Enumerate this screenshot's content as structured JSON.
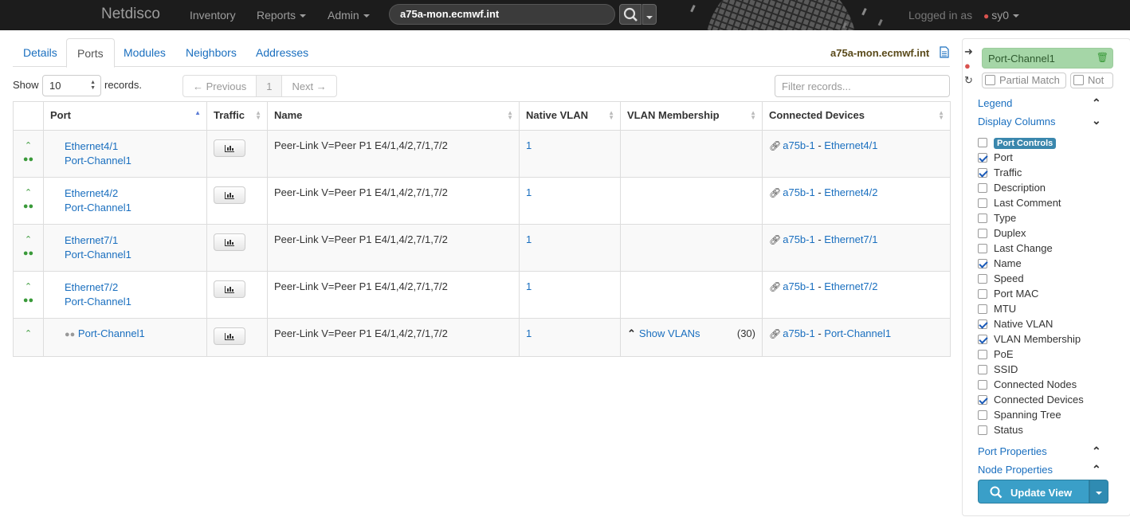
{
  "nav": {
    "brand": "Netdisco",
    "items": [
      {
        "label": "Inventory",
        "dropdown": false
      },
      {
        "label": "Reports",
        "dropdown": true
      },
      {
        "label": "Admin",
        "dropdown": true
      }
    ],
    "search_value": "a75a-mon.ecmwf.int",
    "logged_in_label": "Logged in as",
    "user": "sy0"
  },
  "tabs": [
    "Details",
    "Ports",
    "Modules",
    "Neighbors",
    "Addresses"
  ],
  "active_tab": "Ports",
  "device_title": "a75a-mon.ecmwf.int",
  "controls": {
    "show_label": "Show",
    "show_value": "10",
    "records_label": "records.",
    "prev": "← Previous",
    "page": "1",
    "next": "Next →",
    "filter_placeholder": "Filter records..."
  },
  "table": {
    "headers": [
      "",
      "Port",
      "Traffic",
      "Name",
      "Native VLAN",
      "VLAN Membership",
      "Connected Devices"
    ],
    "rows": [
      {
        "port": "Ethernet4/1",
        "channel": "Port-Channel1",
        "name": "Peer-Link V=Peer P1 E4/1,4/2,7/1,7/2",
        "native_vlan": "1",
        "vlan_membership": "",
        "vlan_count": "",
        "device": "a75b-1",
        "device_sep": " - ",
        "remote_port": "Ethernet4/1"
      },
      {
        "port": "Ethernet4/2",
        "channel": "Port-Channel1",
        "name": "Peer-Link V=Peer P1 E4/1,4/2,7/1,7/2",
        "native_vlan": "1",
        "vlan_membership": "",
        "vlan_count": "",
        "device": "a75b-1",
        "device_sep": " - ",
        "remote_port": "Ethernet4/2"
      },
      {
        "port": "Ethernet7/1",
        "channel": "Port-Channel1",
        "name": "Peer-Link V=Peer P1 E4/1,4/2,7/1,7/2",
        "native_vlan": "1",
        "vlan_membership": "",
        "vlan_count": "",
        "device": "a75b-1",
        "device_sep": " - ",
        "remote_port": "Ethernet7/1"
      },
      {
        "port": "Ethernet7/2",
        "channel": "Port-Channel1",
        "name": "Peer-Link V=Peer P1 E4/1,4/2,7/1,7/2",
        "native_vlan": "1",
        "vlan_membership": "",
        "vlan_count": "",
        "device": "a75b-1",
        "device_sep": " - ",
        "remote_port": "Ethernet7/2"
      },
      {
        "port": "Port-Channel1",
        "channel": "",
        "name": "Peer-Link V=Peer P1 E4/1,4/2,7/1,7/2",
        "native_vlan": "1",
        "vlan_membership": "Show VLANs",
        "vlan_count": "(30)",
        "device": "a75b-1",
        "device_sep": " - ",
        "remote_port": "Port-Channel1"
      }
    ]
  },
  "sidebar": {
    "query": "Port-Channel1",
    "partial_match": "Partial Match",
    "not_label": "Not",
    "legend": "Legend",
    "display_columns": "Display Columns",
    "columns": [
      {
        "label": "Port Controls",
        "checked": false,
        "badge": true
      },
      {
        "label": "Port",
        "checked": true
      },
      {
        "label": "Traffic",
        "checked": true
      },
      {
        "label": "Description",
        "checked": false
      },
      {
        "label": "Last Comment",
        "checked": false
      },
      {
        "label": "Type",
        "checked": false
      },
      {
        "label": "Duplex",
        "checked": false
      },
      {
        "label": "Last Change",
        "checked": false
      },
      {
        "label": "Name",
        "checked": true
      },
      {
        "label": "Speed",
        "checked": false
      },
      {
        "label": "Port MAC",
        "checked": false
      },
      {
        "label": "MTU",
        "checked": false
      },
      {
        "label": "Native VLAN",
        "checked": true
      },
      {
        "label": "VLAN Membership",
        "checked": true
      },
      {
        "label": "PoE",
        "checked": false
      },
      {
        "label": "SSID",
        "checked": false
      },
      {
        "label": "Connected Nodes",
        "checked": false
      },
      {
        "label": "Connected Devices",
        "checked": true
      },
      {
        "label": "Spanning Tree",
        "checked": false
      },
      {
        "label": "Status",
        "checked": false
      }
    ],
    "port_properties": "Port Properties",
    "node_properties": "Node Properties",
    "update_view": "Update View"
  },
  "colors": {
    "navbar": "#1c1c1c",
    "link": "#1a6fbf",
    "query_bg": "#a5d6a7",
    "update_button": "#3a9fc8",
    "status_green": "#3a9a3a"
  }
}
